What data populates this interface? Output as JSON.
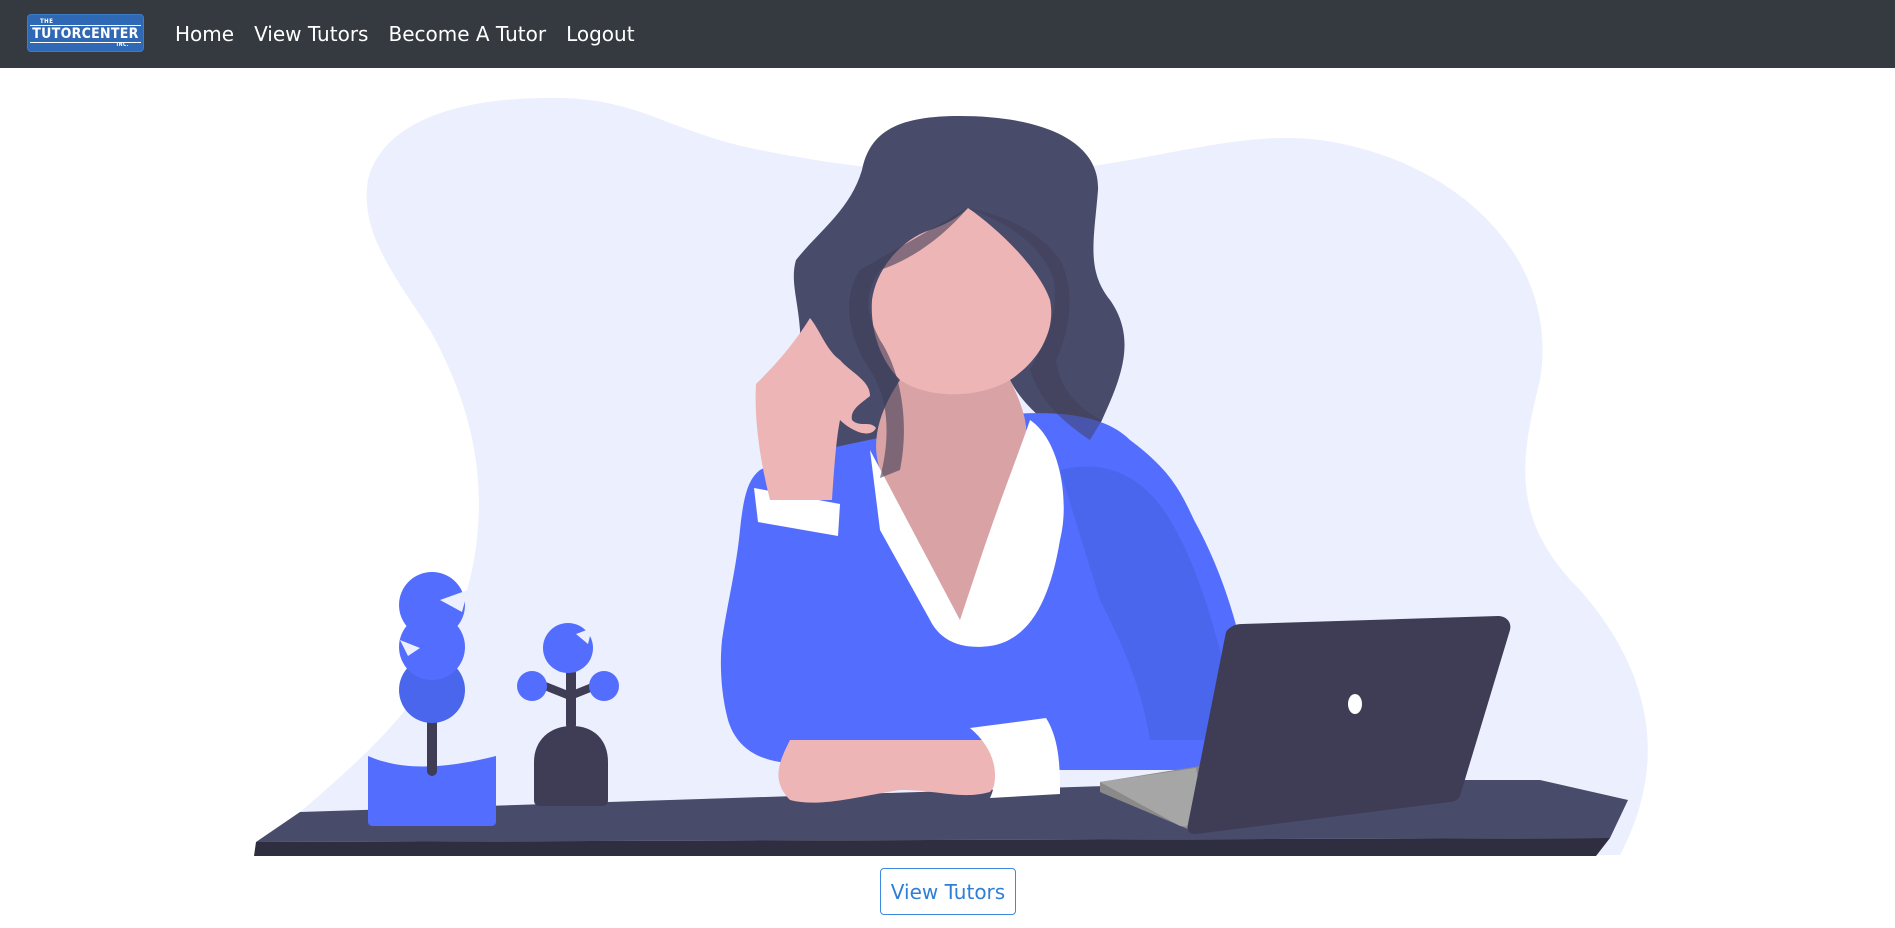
{
  "brand": {
    "top": "THE",
    "name": "TUTORCENTER",
    "bottom": "INC."
  },
  "nav": {
    "home": "Home",
    "view_tutors": "View Tutors",
    "become_tutor": "Become A Tutor",
    "logout": "Logout"
  },
  "hero": {
    "cta_label": "View Tutors"
  },
  "colors": {
    "navbar": "#343a40",
    "brand": "#2f69b5",
    "accent_blue": "#536dfe",
    "blob": "#eceffd",
    "dark": "#3f3d56",
    "skin": "#eeb5b7"
  }
}
